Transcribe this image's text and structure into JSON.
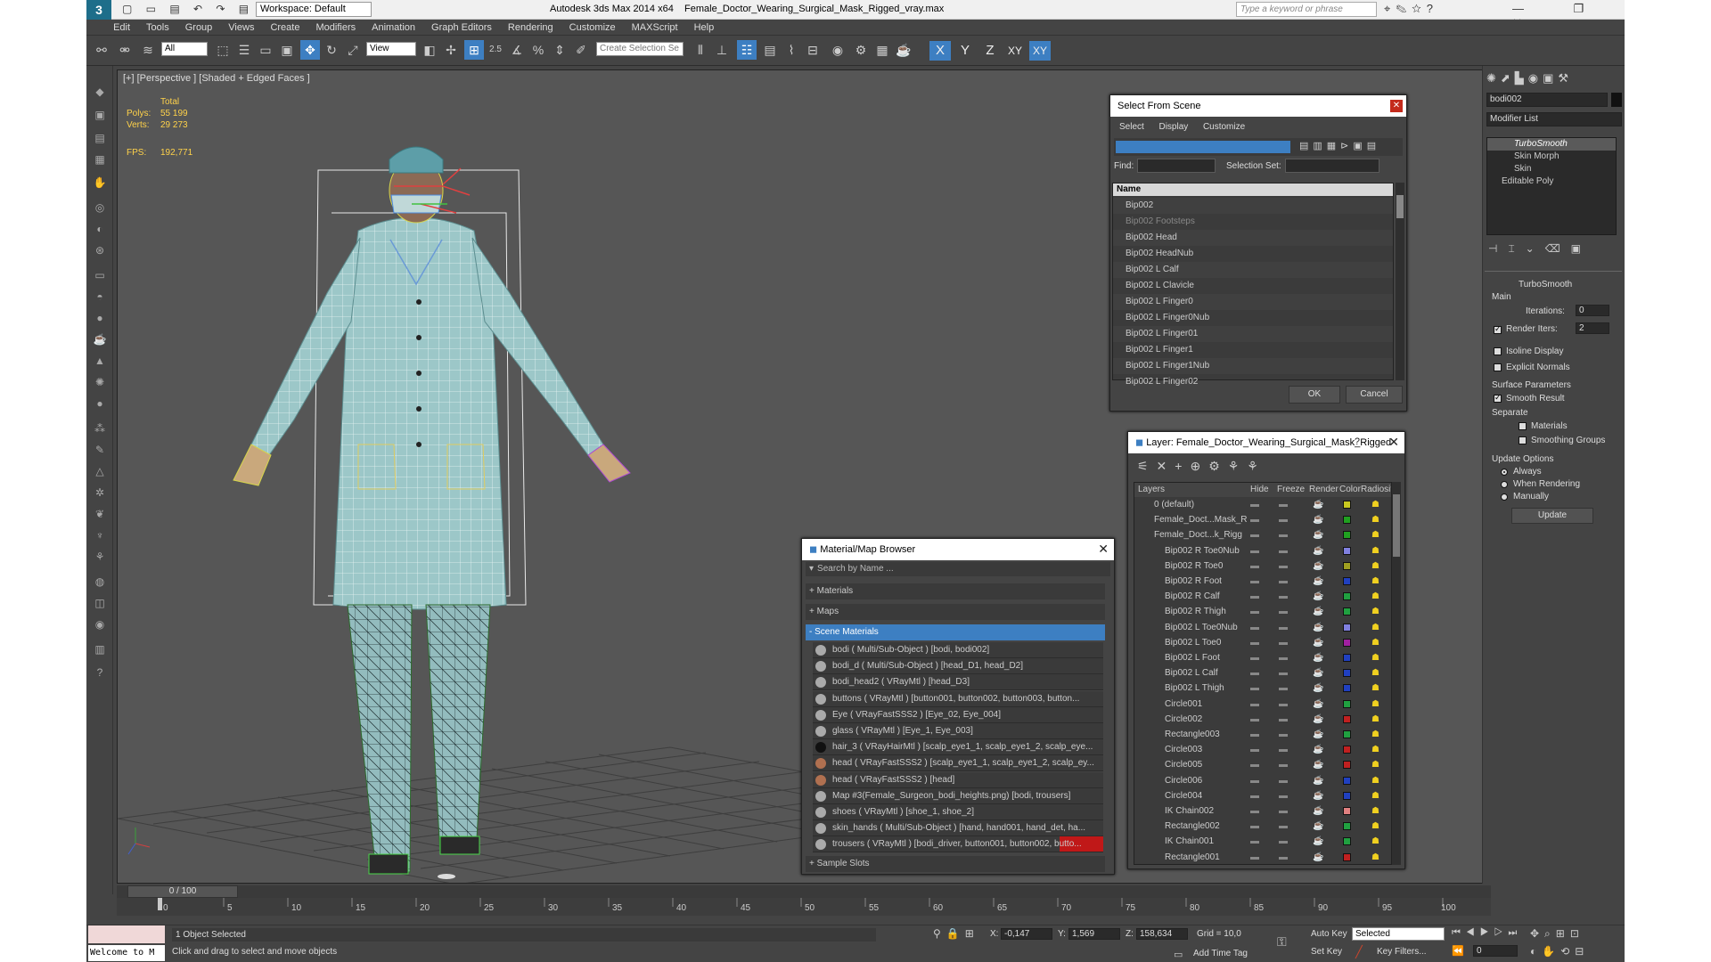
{
  "titlebar": {
    "logo": "3",
    "quick_access": "▢ ▭ ▤ ↶ ↷ ▤",
    "workspace": "Workspace: Default",
    "app_title": "Autodesk 3ds Max  2014 x64",
    "file_title": "Female_Doctor_Wearing_Surgical_Mask_Rigged_vray.max",
    "search_placeholder": "Type a keyword or phrase",
    "win_buttons": "— ❐ ✕"
  },
  "menu": [
    "Edit",
    "Tools",
    "Group",
    "Views",
    "Create",
    "Modifiers",
    "Animation",
    "Graph Editors",
    "Rendering",
    "Customize",
    "MAXScript",
    "Help"
  ],
  "toolbar": {
    "filter": "All",
    "ref_coord": "View",
    "selection_set": "Create Selection Se",
    "snap_label": "2.5",
    "angle_label": "%",
    "axes": [
      "X",
      "Y",
      "Z",
      "XY",
      "XY"
    ]
  },
  "viewport": {
    "label": "[+] [Perspective ] [Shaded + Edged Faces ]",
    "stats": {
      "total_label": "Total",
      "polys_label": "Polys:",
      "polys_value": "55 199",
      "verts_label": "Verts:",
      "verts_value": "29 273",
      "fps_label": "FPS:",
      "fps_value": "192,771"
    }
  },
  "select_from_scene": {
    "title": "Select From Scene",
    "menu": [
      "Select",
      "Display",
      "Customize"
    ],
    "find_label": "Find:",
    "selection_set_label": "Selection Set:",
    "column_name": "Name",
    "items": [
      "Bip002",
      "Bip002 Footsteps",
      "Bip002 Head",
      "Bip002 HeadNub",
      "Bip002 L Calf",
      "Bip002 L Clavicle",
      "Bip002 L Finger0",
      "Bip002 L Finger0Nub",
      "Bip002 L Finger01",
      "Bip002 L Finger1",
      "Bip002 L Finger1Nub",
      "Bip002 L Finger02"
    ],
    "ok": "OK",
    "cancel": "Cancel"
  },
  "layer_dialog": {
    "title": "Layer: Female_Doctor_Wearing_Surgical_Mask_Rigged",
    "help": "?",
    "columns": [
      "Layers",
      "Hide",
      "Freeze",
      "Render",
      "Color",
      "Radiosity"
    ],
    "rows": [
      {
        "name": "0 (default)",
        "color": "#c8c820"
      },
      {
        "name": "Female_Doct...Mask_R",
        "color": "#20a020"
      },
      {
        "name": "Female_Doct...k_Rigg",
        "color": "#20a020"
      },
      {
        "name": "Bip002 R Toe0Nub",
        "color": "#8080e0"
      },
      {
        "name": "Bip002 R Toe0",
        "color": "#a0a020"
      },
      {
        "name": "Bip002 R Foot",
        "color": "#2040c0"
      },
      {
        "name": "Bip002 R Calf",
        "color": "#20a040"
      },
      {
        "name": "Bip002 R Thigh",
        "color": "#20a040"
      },
      {
        "name": "Bip002 L Toe0Nub",
        "color": "#8080e0"
      },
      {
        "name": "Bip002 L Toe0",
        "color": "#a020a0"
      },
      {
        "name": "Bip002 L Foot",
        "color": "#2040c0"
      },
      {
        "name": "Bip002 L Calf",
        "color": "#2040c0"
      },
      {
        "name": "Bip002 L Thigh",
        "color": "#2040c0"
      },
      {
        "name": "Circle001",
        "color": "#20a040"
      },
      {
        "name": "Circle002",
        "color": "#c02020"
      },
      {
        "name": "Rectangle003",
        "color": "#20a040"
      },
      {
        "name": "Circle003",
        "color": "#c02020"
      },
      {
        "name": "Circle005",
        "color": "#c02020"
      },
      {
        "name": "Circle006",
        "color": "#2040c0"
      },
      {
        "name": "Circle004",
        "color": "#2040c0"
      },
      {
        "name": "IK Chain002",
        "color": "#e08080"
      },
      {
        "name": "Rectangle002",
        "color": "#20a040"
      },
      {
        "name": "IK Chain001",
        "color": "#20a040"
      },
      {
        "name": "Rectangle001",
        "color": "#c02020"
      }
    ]
  },
  "material_browser": {
    "title": "Material/Map Browser",
    "search_placeholder": "Search by Name ...",
    "groups": [
      "+ Materials",
      "+ Maps",
      "- Scene Materials"
    ],
    "items": [
      "bodi  ( Multi/Sub-Object ) [bodi, bodi002]",
      "bodi_d  ( Multi/Sub-Object ) [head_D1, head_D2]",
      "bodi_head2  ( VRayMtl ) [head_D3]",
      "buttons  ( VRayMtl ) [button001, button002, button003, button...",
      "Eye  ( VRayFastSSS2 ) [Eye_02, Eye_004]",
      "glass  ( VRayMtl ) [Eye_1, Eye_003]",
      "hair_3  ( VRayHairMtl ) [scalp_eye1_1, scalp_eye1_2, scalp_eye...",
      "head  ( VRayFastSSS2 ) [scalp_eye1_1, scalp_eye1_2, scalp_ey...",
      "head  ( VRayFastSSS2 ) [head]",
      "Map #3(Female_Surgeon_bodi_heights.png) [bodi, trousers]",
      "shoes  ( VRayMtl ) [shoe_1, shoe_2]",
      "skin_hands  ( Multi/Sub-Object ) [hand, hand001, hand_det, ha...",
      "trousers  ( VRayMtl ) [bodi_driver, button001, button002, butto..."
    ],
    "footer": "+ Sample Slots"
  },
  "command_panel": {
    "object_name": "bodi002",
    "modifier_list": "Modifier List",
    "stack": [
      "TurboSmooth",
      "Skin Morph",
      "Skin",
      "Editable Poly"
    ],
    "rollout_title": "TurboSmooth",
    "main": "Main",
    "iterations_label": "Iterations:",
    "iterations_value": "0",
    "render_iters_label": "Render Iters:",
    "render_iters_value": "2",
    "isoline": "Isoline Display",
    "explicit": "Explicit Normals",
    "surface_params": "Surface Parameters",
    "smooth_result": "Smooth Result",
    "separate": "Separate",
    "materials": "Materials",
    "smoothing_groups": "Smoothing Groups",
    "update_options": "Update Options",
    "always": "Always",
    "when_rendering": "When Rendering",
    "manually": "Manually",
    "update": "Update"
  },
  "timeline": {
    "frame": "0 / 100",
    "ticks": [
      "0",
      "5",
      "10",
      "15",
      "20",
      "25",
      "30",
      "35",
      "40",
      "45",
      "50",
      "55",
      "60",
      "65",
      "70",
      "75",
      "80",
      "85",
      "90",
      "95",
      "100"
    ]
  },
  "status": {
    "script_field": "Welcome to M",
    "selected": "1 Object Selected",
    "prompt": "Click and drag to select and move objects",
    "x_label": "X:",
    "x_value": "-0,147",
    "y_label": "Y:",
    "y_value": "1,569",
    "z_label": "Z:",
    "z_value": "158,634",
    "grid": "Grid = 10,0",
    "add_time_tag": "Add Time Tag",
    "auto_key": "Auto Key",
    "set_key": "Set Key",
    "selected_dropdown": "Selected",
    "key_filters": "Key Filters...",
    "frame_field": "0"
  }
}
